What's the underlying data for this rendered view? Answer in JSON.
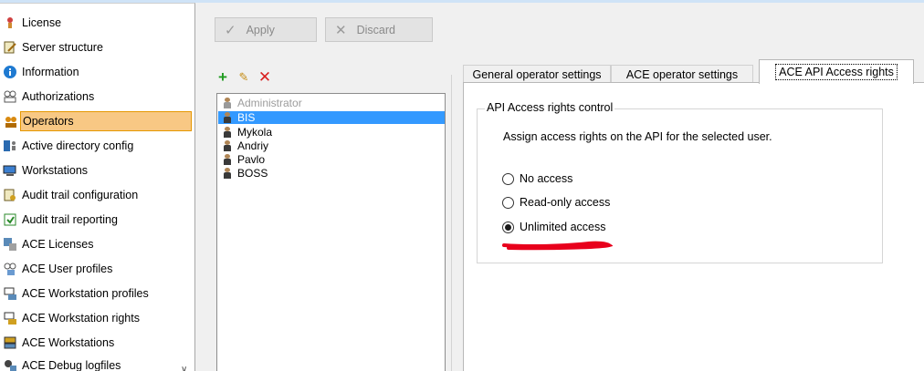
{
  "nav": {
    "items": [
      {
        "label": "License",
        "icon": "license-icon",
        "selected": false
      },
      {
        "label": "Server structure",
        "icon": "server-structure-icon",
        "selected": false
      },
      {
        "label": "Information",
        "icon": "info-icon",
        "selected": false
      },
      {
        "label": "Authorizations",
        "icon": "authorizations-icon",
        "selected": false
      },
      {
        "label": "Operators",
        "icon": "operators-icon",
        "selected": true
      },
      {
        "label": "Active directory config",
        "icon": "active-directory-icon",
        "selected": false
      },
      {
        "label": "Workstations",
        "icon": "workstations-icon",
        "selected": false
      },
      {
        "label": "Audit trail configuration",
        "icon": "audit-config-icon",
        "selected": false
      },
      {
        "label": "Audit trail reporting",
        "icon": "audit-reporting-icon",
        "selected": false
      },
      {
        "label": "ACE Licenses",
        "icon": "ace-licenses-icon",
        "selected": false
      },
      {
        "label": "ACE User profiles",
        "icon": "ace-user-profiles-icon",
        "selected": false
      },
      {
        "label": "ACE Workstation profiles",
        "icon": "ace-workstation-profiles-icon",
        "selected": false
      },
      {
        "label": "ACE Workstation rights",
        "icon": "ace-workstation-rights-icon",
        "selected": false
      },
      {
        "label": "ACE Workstations",
        "icon": "ace-workstations-icon",
        "selected": false
      },
      {
        "label": "ACE Debug logfiles",
        "icon": "ace-debug-icon",
        "selected": false
      }
    ]
  },
  "toolbar": {
    "apply_label": "Apply",
    "discard_label": "Discard"
  },
  "operators": {
    "list": [
      {
        "name": "Administrator",
        "state": "disabled"
      },
      {
        "name": "BIS",
        "state": "selected"
      },
      {
        "name": "Mykola",
        "state": "normal"
      },
      {
        "name": "Andriy",
        "state": "normal"
      },
      {
        "name": "Pavlo",
        "state": "normal"
      },
      {
        "name": "BOSS",
        "state": "normal"
      }
    ]
  },
  "tabs": [
    {
      "label": "General operator settings",
      "active": false
    },
    {
      "label": "ACE operator settings",
      "active": false
    },
    {
      "label": "ACE API Access rights",
      "active": true
    }
  ],
  "api_access": {
    "group_title": "API Access rights control",
    "description": "Assign access rights on the API for the selected user.",
    "options": [
      {
        "label": "No access",
        "checked": false
      },
      {
        "label": "Read-only access",
        "checked": false
      },
      {
        "label": "Unlimited access",
        "checked": true
      }
    ]
  },
  "colors": {
    "nav_selected_bg": "#f8c884",
    "list_selected_bg": "#3399ff",
    "annotation_red": "#e8001c"
  }
}
